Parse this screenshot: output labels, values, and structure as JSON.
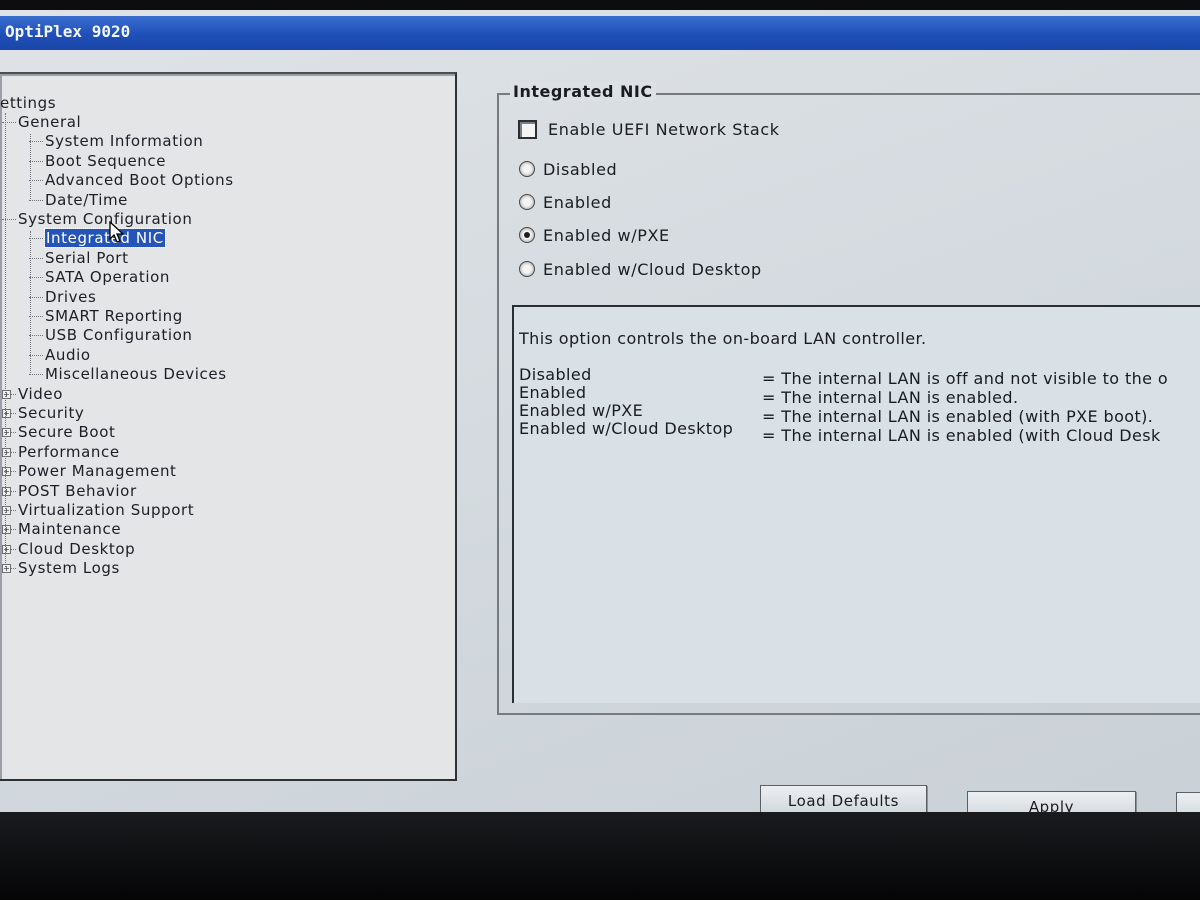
{
  "window": {
    "title": "OptiPlex 9020"
  },
  "tree": {
    "root": "ettings",
    "nodes": [
      {
        "id": "general",
        "label": "General",
        "level": 1,
        "expander": "-"
      },
      {
        "id": "system-information",
        "label": "System Information",
        "level": 2
      },
      {
        "id": "boot-sequence",
        "label": "Boot Sequence",
        "level": 2
      },
      {
        "id": "advanced-boot-options",
        "label": "Advanced Boot Options",
        "level": 2
      },
      {
        "id": "date-time",
        "label": "Date/Time",
        "level": 2
      },
      {
        "id": "system-configuration",
        "label": "System Configuration",
        "level": 1,
        "expander": "-"
      },
      {
        "id": "integrated-nic",
        "label": "Integrated NIC",
        "level": 2,
        "selected": true
      },
      {
        "id": "serial-port",
        "label": "Serial Port",
        "level": 2
      },
      {
        "id": "sata-operation",
        "label": "SATA Operation",
        "level": 2
      },
      {
        "id": "drives",
        "label": "Drives",
        "level": 2
      },
      {
        "id": "smart-reporting",
        "label": "SMART Reporting",
        "level": 2
      },
      {
        "id": "usb-configuration",
        "label": "USB Configuration",
        "level": 2
      },
      {
        "id": "audio",
        "label": "Audio",
        "level": 2
      },
      {
        "id": "miscellaneous-devices",
        "label": "Miscellaneous Devices",
        "level": 2
      },
      {
        "id": "video",
        "label": "Video",
        "level": 1,
        "expander": "+"
      },
      {
        "id": "security",
        "label": "Security",
        "level": 1,
        "expander": "+"
      },
      {
        "id": "secure-boot",
        "label": "Secure Boot",
        "level": 1,
        "expander": "+"
      },
      {
        "id": "performance",
        "label": "Performance",
        "level": 1,
        "expander": "+"
      },
      {
        "id": "power-management",
        "label": "Power Management",
        "level": 1,
        "expander": "+"
      },
      {
        "id": "post-behavior",
        "label": "POST Behavior",
        "level": 1,
        "expander": "+"
      },
      {
        "id": "virtualization-support",
        "label": "Virtualization Support",
        "level": 1,
        "expander": "+"
      },
      {
        "id": "maintenance",
        "label": "Maintenance",
        "level": 1,
        "expander": "+"
      },
      {
        "id": "cloud-desktop",
        "label": "Cloud Desktop",
        "level": 1,
        "expander": "+"
      },
      {
        "id": "system-logs",
        "label": "System Logs",
        "level": 1,
        "expander": "+"
      }
    ]
  },
  "panel": {
    "title": "Integrated NIC",
    "checkbox": {
      "label": "Enable UEFI Network Stack",
      "checked": false
    },
    "radios": [
      {
        "label": "Disabled",
        "selected": false
      },
      {
        "label": "Enabled",
        "selected": false
      },
      {
        "label": "Enabled w/PXE",
        "selected": true
      },
      {
        "label": "Enabled w/Cloud Desktop",
        "selected": false
      }
    ],
    "help": {
      "intro": "This option controls the on-board LAN controller.",
      "rows": [
        {
          "term": "Disabled",
          "desc": "= The internal LAN is off and not visible to the o"
        },
        {
          "term": "Enabled",
          "desc": "= The internal LAN is enabled."
        },
        {
          "term": "Enabled w/PXE",
          "desc": "= The internal LAN is enabled (with PXE boot)."
        },
        {
          "term": "Enabled w/Cloud Desktop",
          "desc": "= The internal LAN is enabled (with Cloud Desk"
        }
      ]
    }
  },
  "buttons": {
    "load_defaults": "Load Defaults",
    "apply": "Apply"
  }
}
